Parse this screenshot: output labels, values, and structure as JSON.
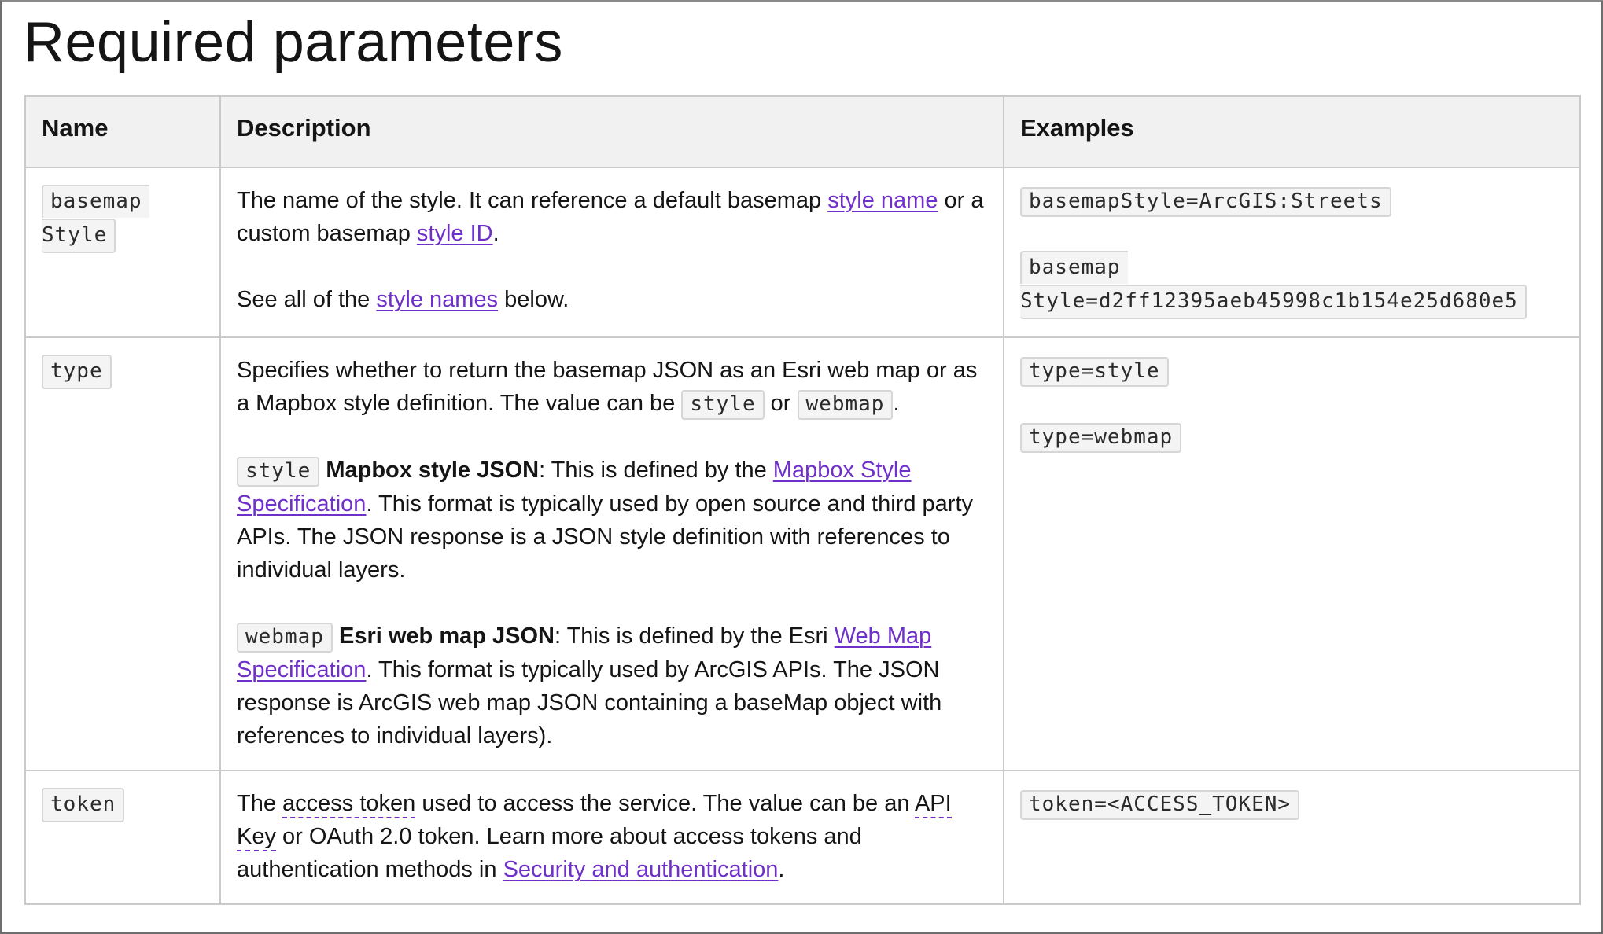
{
  "page_title": "Required parameters",
  "table": {
    "headers": {
      "name": "Name",
      "description": "Description",
      "examples": "Examples"
    },
    "rows": [
      {
        "name": [
          "basemap",
          "Style"
        ],
        "description": {
          "p1": {
            "t1": "The name of the style. It can reference a default basemap ",
            "link1": "style name",
            "t2": " or a custom basemap ",
            "link2": "style ID",
            "t3": "."
          },
          "p2": {
            "t1": "See all of the ",
            "link1": "style names",
            "t2": " below."
          }
        },
        "examples": [
          {
            "lines": [
              "basemapStyle=ArcGIS:Streets"
            ]
          },
          {
            "lines": [
              "basemap",
              "Style=d2ff12395aeb45998c1b154e25d680e5"
            ]
          }
        ]
      },
      {
        "name": [
          "type"
        ],
        "description": {
          "p1": {
            "t1": "Specifies whether to return the basemap JSON as an Esri web map or as a Mapbox style definition. The value can be ",
            "code1": "style",
            "t2": " or ",
            "code2": "webmap",
            "t3": "."
          },
          "p2": {
            "code": "style",
            "bold": "Mapbox style JSON",
            "t1": ": This is defined by the ",
            "link": "Mapbox Style Specification",
            "t2": ". This format is typically used by open source and third party APIs. The JSON response is a JSON style definition with references to individual layers."
          },
          "p3": {
            "code": "webmap",
            "bold": "Esri web map JSON",
            "t1": ": This is defined by the Esri ",
            "link": "Web Map Specification",
            "t2": ". This format is typically used by ArcGIS APIs. The JSON response is ArcGIS web map JSON containing a baseMap object with references to individual layers)."
          }
        },
        "examples": [
          {
            "lines": [
              "type=style"
            ]
          },
          {
            "lines": [
              "type=webmap"
            ]
          }
        ]
      },
      {
        "name": [
          "token"
        ],
        "description": {
          "p1": {
            "t1": "The ",
            "term1": "access token",
            "t2": " used to access the service. The value can be an ",
            "term2": "API Key",
            "t3": " or OAuth 2.0 token. Learn more about access tokens and authentication methods in ",
            "link": "Security and authentication",
            "t4": "."
          }
        },
        "examples": [
          {
            "lines": [
              "token=<ACCESS_TOKEN>"
            ]
          }
        ]
      }
    ]
  },
  "colors": {
    "link": "#6f2fc9",
    "header_bg": "#f1f1f1",
    "border": "#cacaca",
    "code_bg": "#f4f4f4"
  }
}
